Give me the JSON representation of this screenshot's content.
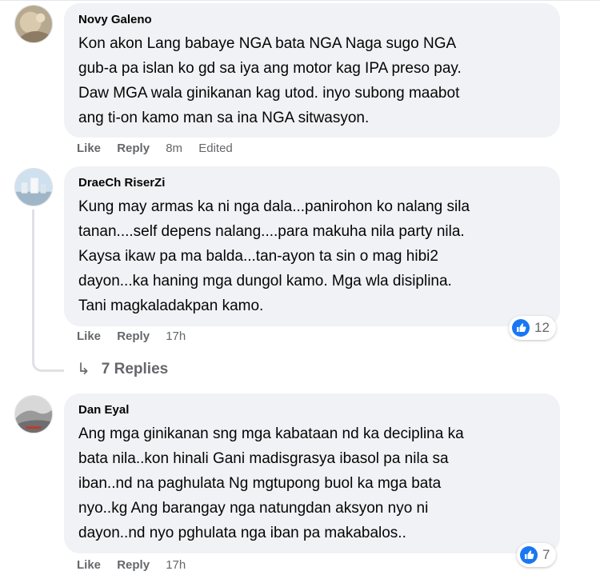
{
  "colors": {
    "bubble": "#f0f2f5",
    "meta": "#65676b",
    "like_blue": "#1877f2",
    "thread_line": "#dfe1e4"
  },
  "comments": [
    {
      "author": "Novy Galeno",
      "text": "Kon akon Lang babaye NGA bata NGA Naga sugo NGA\ngub-a pa islan ko gd sa iya ang motor kag IPA preso pay.\nDaw MGA wala ginikanan kag utod. inyo subong maabot\nang ti-on kamo man sa ina NGA sitwasyon.",
      "like_label": "Like",
      "reply_label": "Reply",
      "time": "8m",
      "edited": "Edited"
    },
    {
      "author": "DraeCh RiserZi",
      "text": "Kung may armas ka ni nga dala...panirohon ko nalang sila\ntanan....self depens nalang....para makuha nila party nila.\nKaysa ikaw pa ma balda...tan-ayon ta sin o mag hibi2\ndayon...ka haning mga dungol kamo. Mga wla disiplina.\nTani magkaladakpan kamo.",
      "like_label": "Like",
      "reply_label": "Reply",
      "time": "17h",
      "reaction_icon": "like-icon",
      "reaction_count": "12",
      "replies_label": "7 Replies"
    },
    {
      "author": "Dan Eyal",
      "text": "Ang mga ginikanan sng mga kabataan nd ka deciplina ka\nbata nila..kon hinali Gani madisgrasya ibasol pa nila sa\niban..nd na paghulata Ng mgtupong buol ka mga bata\nnyo..kg Ang barangay nga natungdan aksyon nyo ni\ndayon..nd nyo pghulata nga iban pa makabalos..",
      "like_label": "Like",
      "reply_label": "Reply",
      "time": "17h",
      "reaction_icon": "like-icon",
      "reaction_count": "7"
    }
  ]
}
